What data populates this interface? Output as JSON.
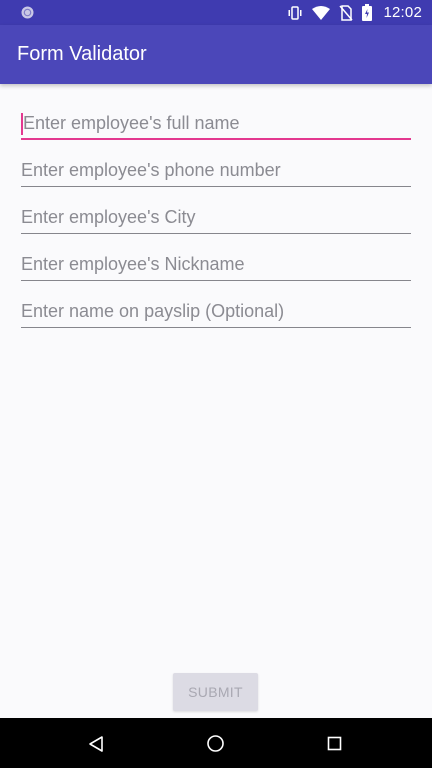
{
  "status_bar": {
    "time": "12:02",
    "icons": [
      "app-notification-icon",
      "vibrate-icon",
      "wifi-icon",
      "no-sim-icon",
      "battery-icon"
    ]
  },
  "app_bar": {
    "title": "Form Validator"
  },
  "form": {
    "fields": [
      {
        "name": "full-name",
        "placeholder": "Enter employee's full name",
        "value": "",
        "focused": true
      },
      {
        "name": "phone",
        "placeholder": "Enter employee's phone number",
        "value": "",
        "focused": false
      },
      {
        "name": "city",
        "placeholder": "Enter employee's City",
        "value": "",
        "focused": false
      },
      {
        "name": "nickname",
        "placeholder": "Enter employee's Nickname",
        "value": "",
        "focused": false
      },
      {
        "name": "payslip-name",
        "placeholder": "Enter name on payslip (Optional)",
        "value": "",
        "focused": false
      }
    ],
    "submit_label": "SUBMIT",
    "submit_enabled": false
  },
  "nav_bar": {
    "icons": [
      "back-icon",
      "home-icon",
      "recents-icon"
    ]
  },
  "colors": {
    "status_bar": "#3f3bb0",
    "app_bar": "#4b47b9",
    "accent": "#e3388f",
    "background": "#fafafc"
  }
}
